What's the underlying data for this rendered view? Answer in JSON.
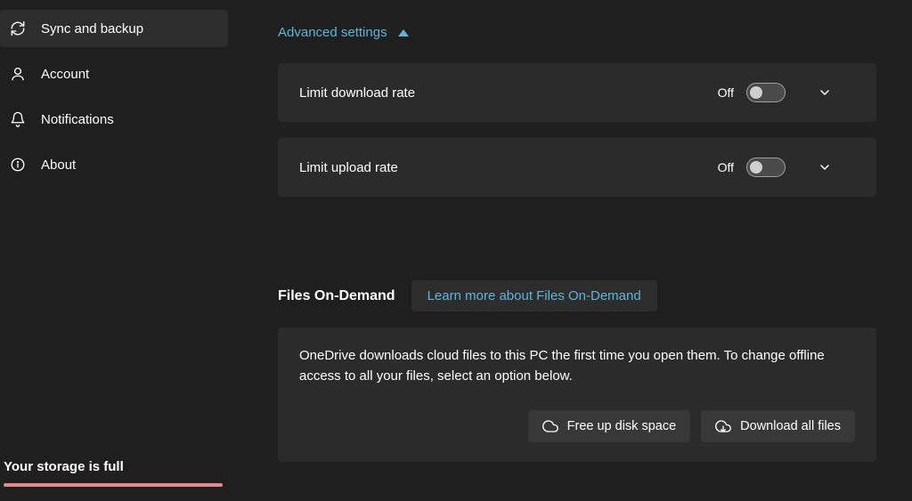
{
  "sidebar": {
    "items": [
      {
        "label": "Sync and backup",
        "active": true
      },
      {
        "label": "Account",
        "active": false
      },
      {
        "label": "Notifications",
        "active": false
      },
      {
        "label": "About",
        "active": false
      }
    ]
  },
  "storage": {
    "label": "Your storage is full",
    "percent_full": 100
  },
  "advanced": {
    "header": "Advanced settings",
    "expanded": true,
    "rates": [
      {
        "label": "Limit download rate",
        "state": "Off",
        "on": false
      },
      {
        "label": "Limit upload rate",
        "state": "Off",
        "on": false
      }
    ]
  },
  "files_on_demand": {
    "title": "Files On-Demand",
    "learn_more": "Learn more about Files On-Demand",
    "description": "OneDrive downloads cloud files to this PC the first time you open them. To change offline access to all your files, select an option below.",
    "free_up": "Free up disk space",
    "download_all": "Download all files"
  }
}
